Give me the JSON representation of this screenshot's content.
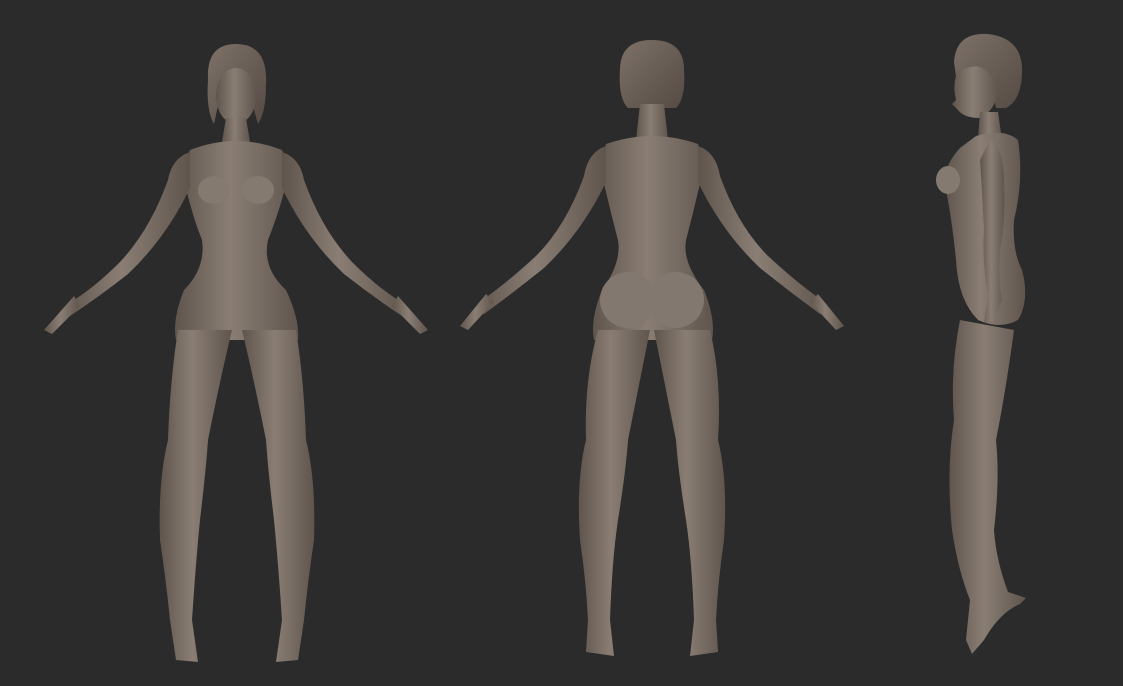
{
  "scene": {
    "background_color": "#2b2b2b",
    "model_color": "#7a6e64",
    "model_shadow_color": "#5a5049",
    "model_highlight_color": "#958a80",
    "hair_color": "#6e6259",
    "views": [
      {
        "view": "front",
        "icon": "front-view-figure"
      },
      {
        "view": "back",
        "icon": "back-view-figure"
      },
      {
        "view": "side",
        "icon": "side-view-figure"
      }
    ]
  }
}
